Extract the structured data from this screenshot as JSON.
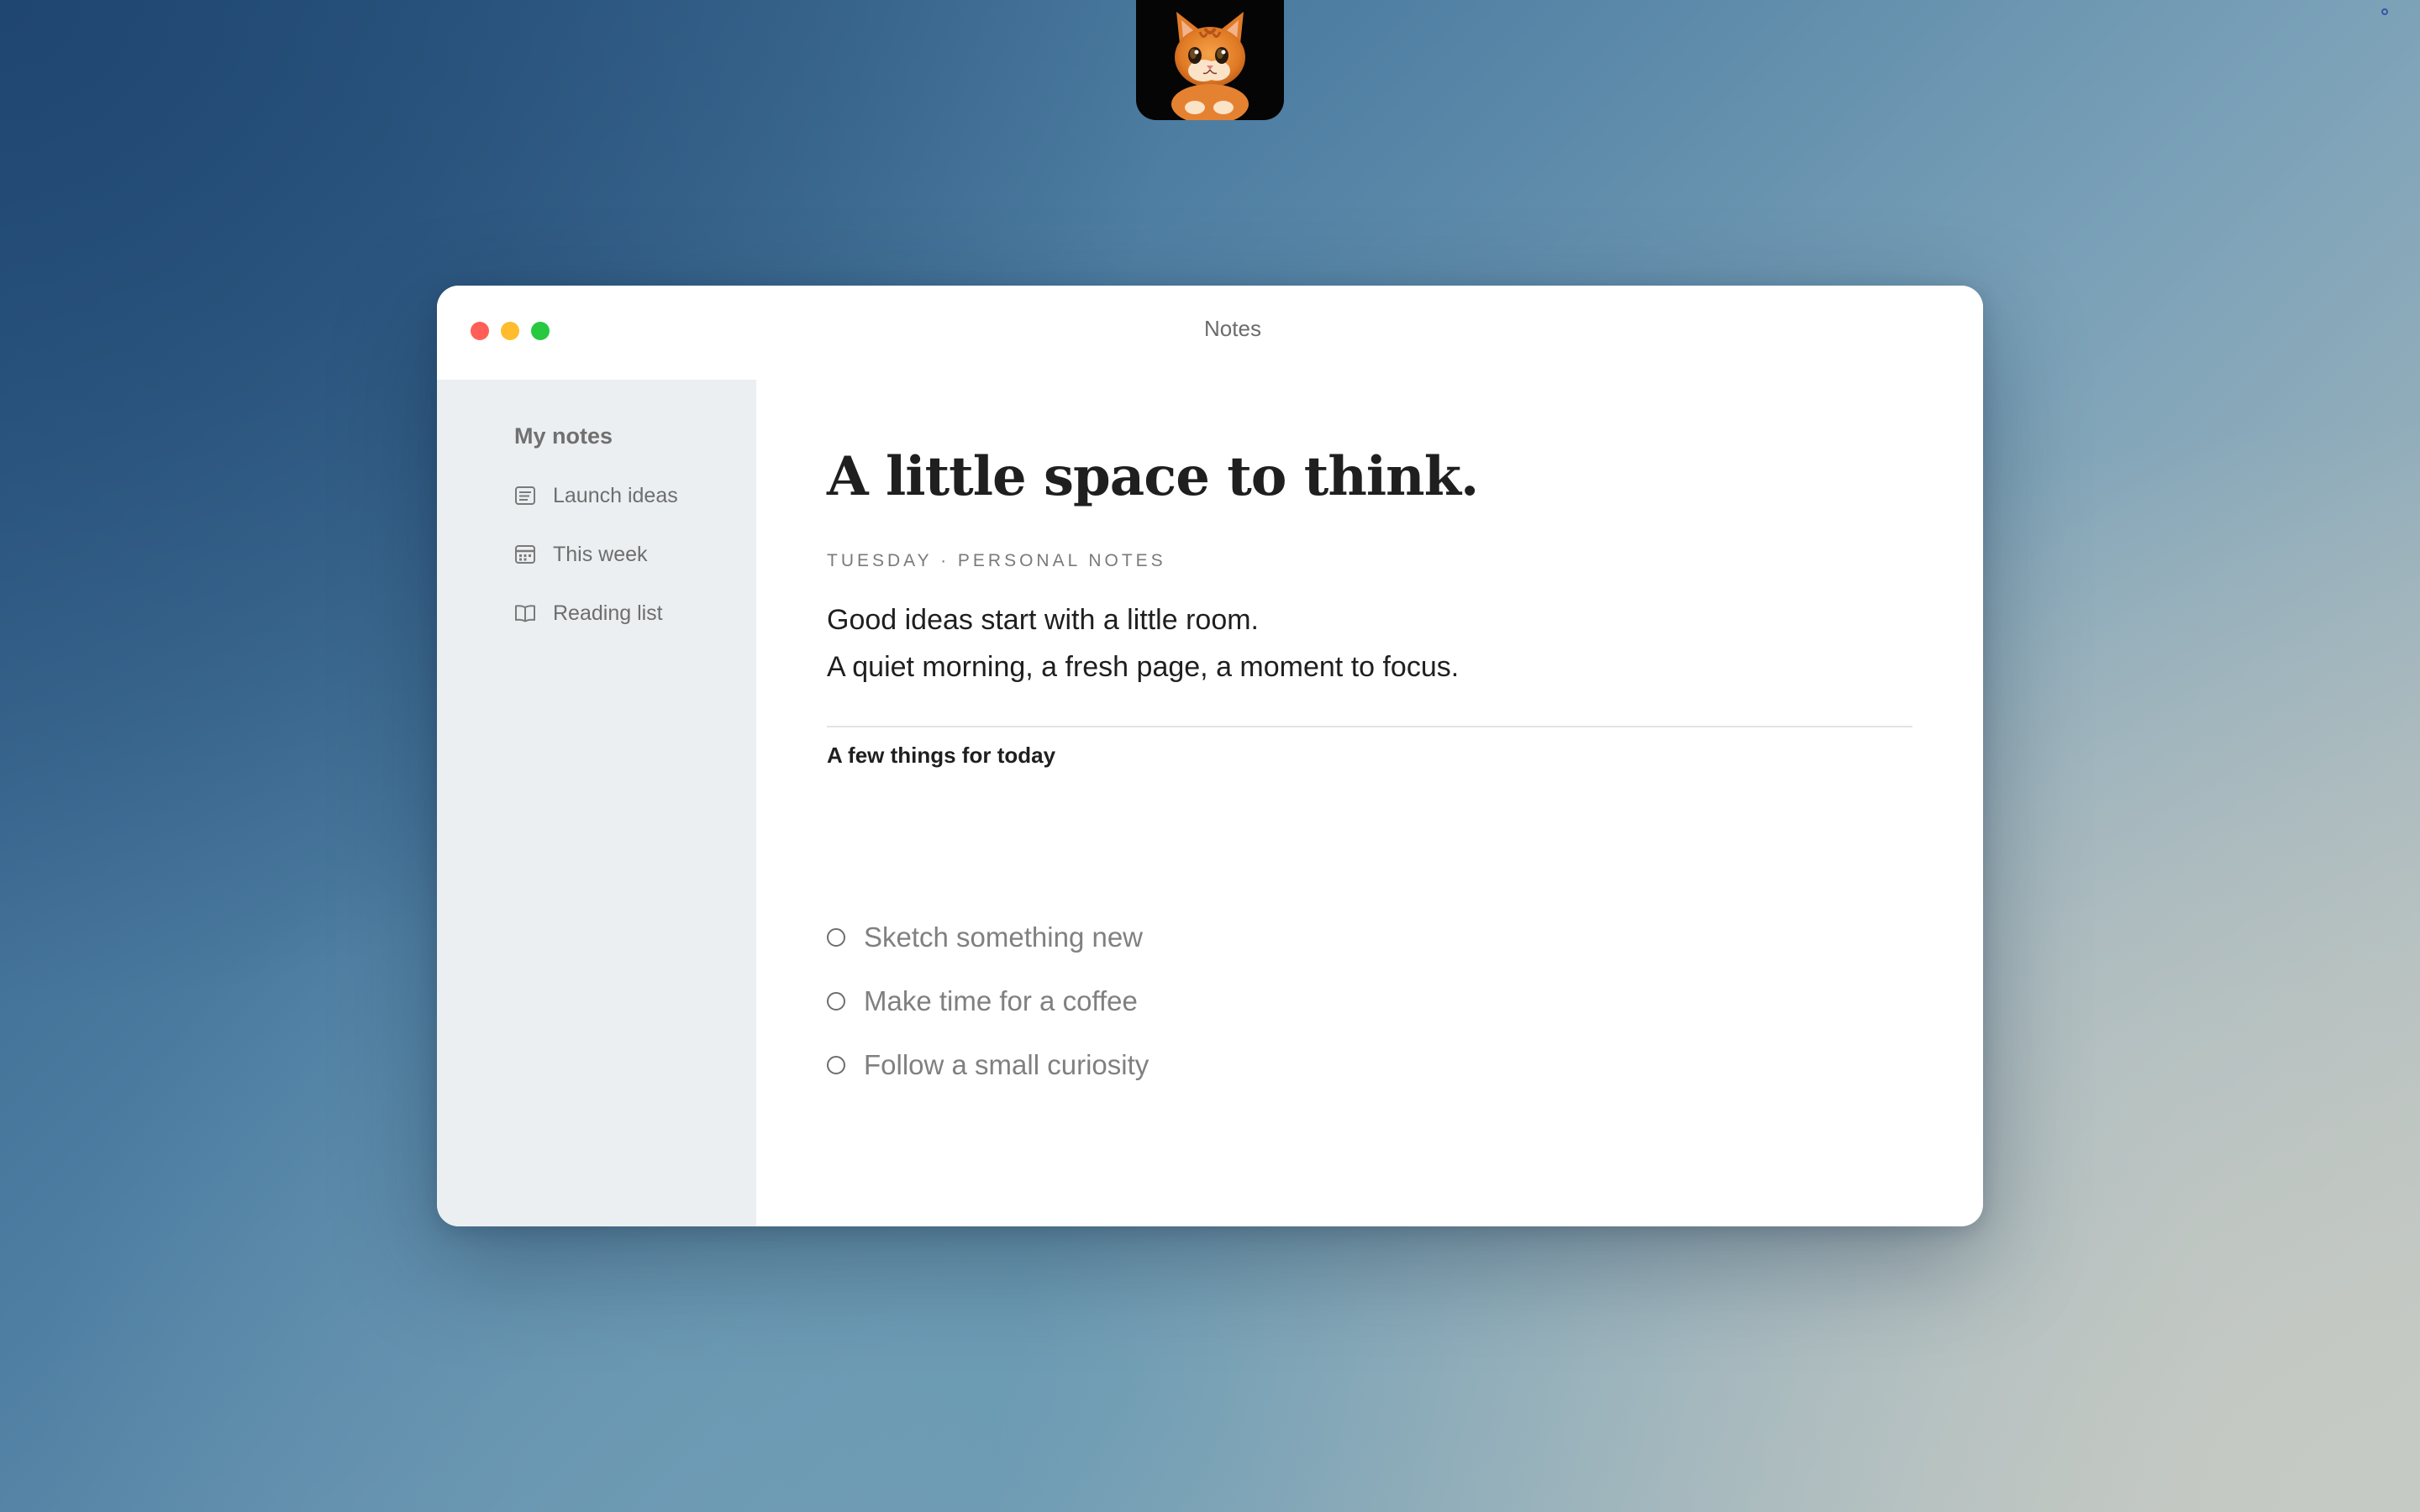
{
  "window": {
    "title": "Notes"
  },
  "sidebar": {
    "heading": "My notes",
    "items": [
      {
        "label": "Launch ideas",
        "icon": "note-icon"
      },
      {
        "label": "This week",
        "icon": "calendar-icon"
      },
      {
        "label": "Reading list",
        "icon": "book-icon"
      }
    ]
  },
  "note": {
    "title": "A little space to think.",
    "meta": "TUESDAY · PERSONAL NOTES",
    "body_lines": [
      "Good ideas start with a little room.",
      "A quiet morning, a fresh page, a moment to focus."
    ],
    "section_heading": "A few things for today",
    "todos": [
      {
        "label": "Sketch something new",
        "done": false
      },
      {
        "label": "Make time for a coffee",
        "done": false
      },
      {
        "label": "Follow a small curiosity",
        "done": false
      }
    ]
  },
  "colors": {
    "close": "#ff5f57",
    "minimize": "#febc2e",
    "maximize": "#28c840",
    "sidebar_bg": "#eceff2"
  }
}
